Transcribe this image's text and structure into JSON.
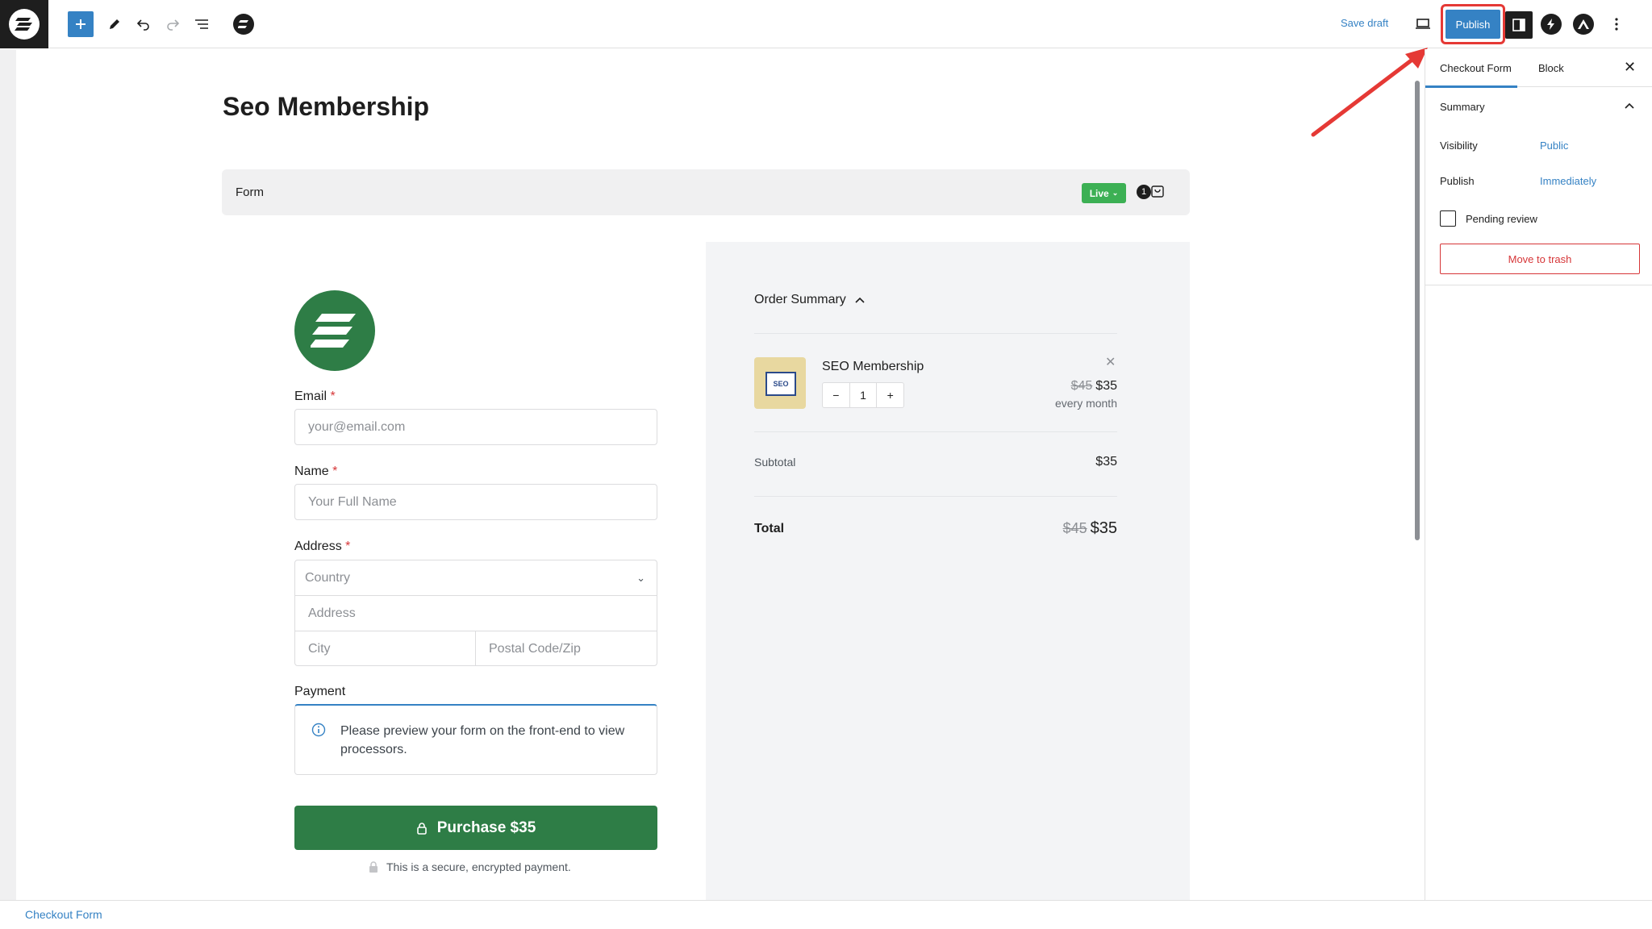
{
  "toolbar": {
    "save_draft_label": "Save draft",
    "publish_label": "Publish"
  },
  "document": {
    "title": "Seo Membership"
  },
  "form_bar": {
    "label": "Form",
    "status_label": "Live",
    "cart_count": "1"
  },
  "checkout": {
    "email_label": "Email",
    "email_placeholder": "your@email.com",
    "name_label": "Name",
    "name_placeholder": "Your Full Name",
    "address_label": "Address",
    "country_placeholder": "Country",
    "address_placeholder": "Address",
    "city_placeholder": "City",
    "postal_placeholder": "Postal Code/Zip",
    "required_marker": "*",
    "payment_label": "Payment",
    "payment_notice": "Please preview your form on the front-end to view processors.",
    "purchase_label": "Purchase $35",
    "secure_note": "This is a secure, encrypted payment."
  },
  "order_summary": {
    "title": "Order Summary",
    "product": {
      "name": "SEO Membership",
      "quantity": "1",
      "qty_minus": "−",
      "qty_plus": "+",
      "original_price": "$45",
      "price": "$35",
      "interval": "every month",
      "thumb_text": "SEO"
    },
    "subtotal_label": "Subtotal",
    "subtotal_value": "$35",
    "total_label": "Total",
    "total_original": "$45",
    "total_value": "$35"
  },
  "sidebar": {
    "tabs": [
      {
        "label": "Checkout Form"
      },
      {
        "label": "Block"
      }
    ],
    "panel_title": "Summary",
    "visibility_label": "Visibility",
    "visibility_value": "Public",
    "publish_label": "Publish",
    "publish_value": "Immediately",
    "pending_review_label": "Pending review",
    "trash_label": "Move to trash"
  },
  "footer": {
    "breadcrumb": "Checkout Form"
  },
  "colors": {
    "accent": "#3582c4",
    "brand_green": "#2e7d46",
    "live_green": "#3cb054",
    "danger": "#d63638",
    "highlight_red": "#e53935"
  }
}
